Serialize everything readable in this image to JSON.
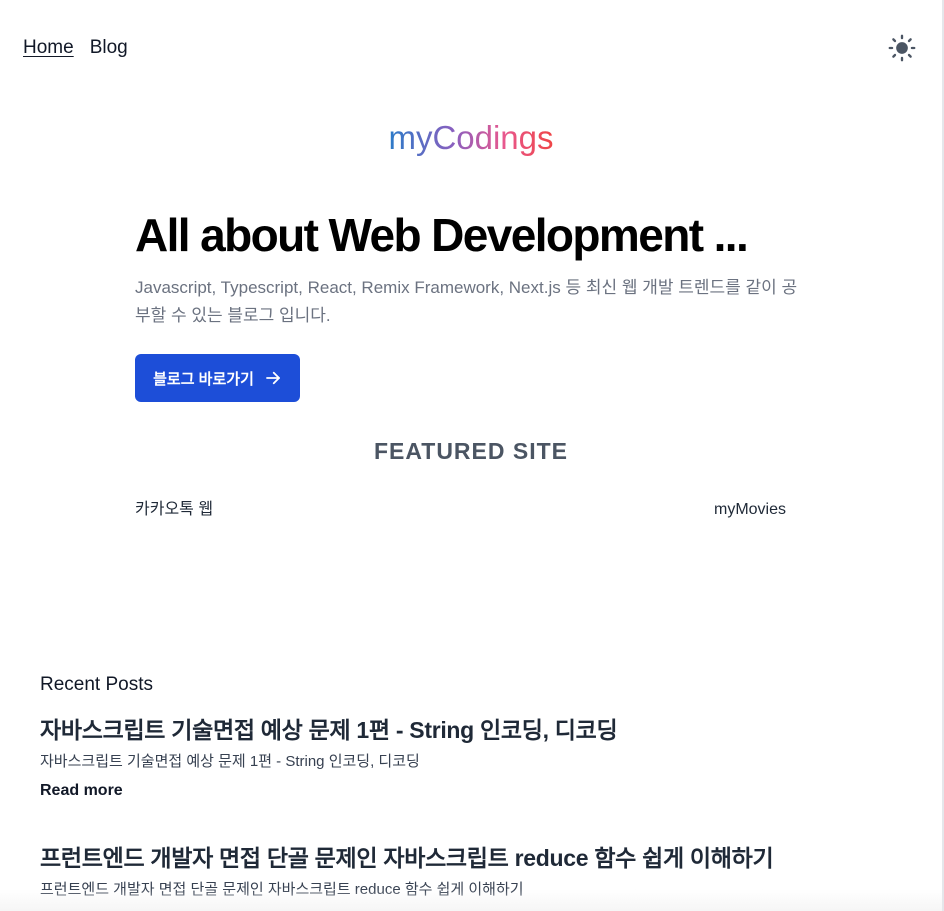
{
  "nav": {
    "items": [
      {
        "label": "Home",
        "active": true
      },
      {
        "label": "Blog",
        "active": false
      }
    ],
    "theme_toggle_icon": "sun-icon"
  },
  "brand": {
    "name": "myCodings"
  },
  "hero": {
    "title": "All about Web Development ...",
    "description": "Javascript, Typescript, React, Remix Framework, Next.js 등 최신 웹 개발 트렌드를 같이 공부할 수 있는 블로그 입니다.",
    "button_label": "블로그 바로가기",
    "button_icon": "arrow-right-icon",
    "button_color": "#1d4ed8"
  },
  "featured": {
    "title": "FEATURED SITE",
    "items": [
      "카카오톡 웹",
      "myMovies"
    ]
  },
  "recent": {
    "title": "Recent Posts",
    "posts": [
      {
        "title": "자바스크립트 기술면접 예상 문제 1편 - String 인코딩, 디코딩",
        "excerpt": "자바스크립트 기술면접 예상 문제 1편 - String 인코딩, 디코딩",
        "more_label": "Read more"
      },
      {
        "title": "프런트엔드 개발자 면접 단골 문제인 자바스크립트 reduce 함수 쉽게 이해하기",
        "excerpt": "프런트엔드 개발자 면접 단골 문제인 자바스크립트 reduce 함수 쉽게 이해하기"
      }
    ]
  }
}
